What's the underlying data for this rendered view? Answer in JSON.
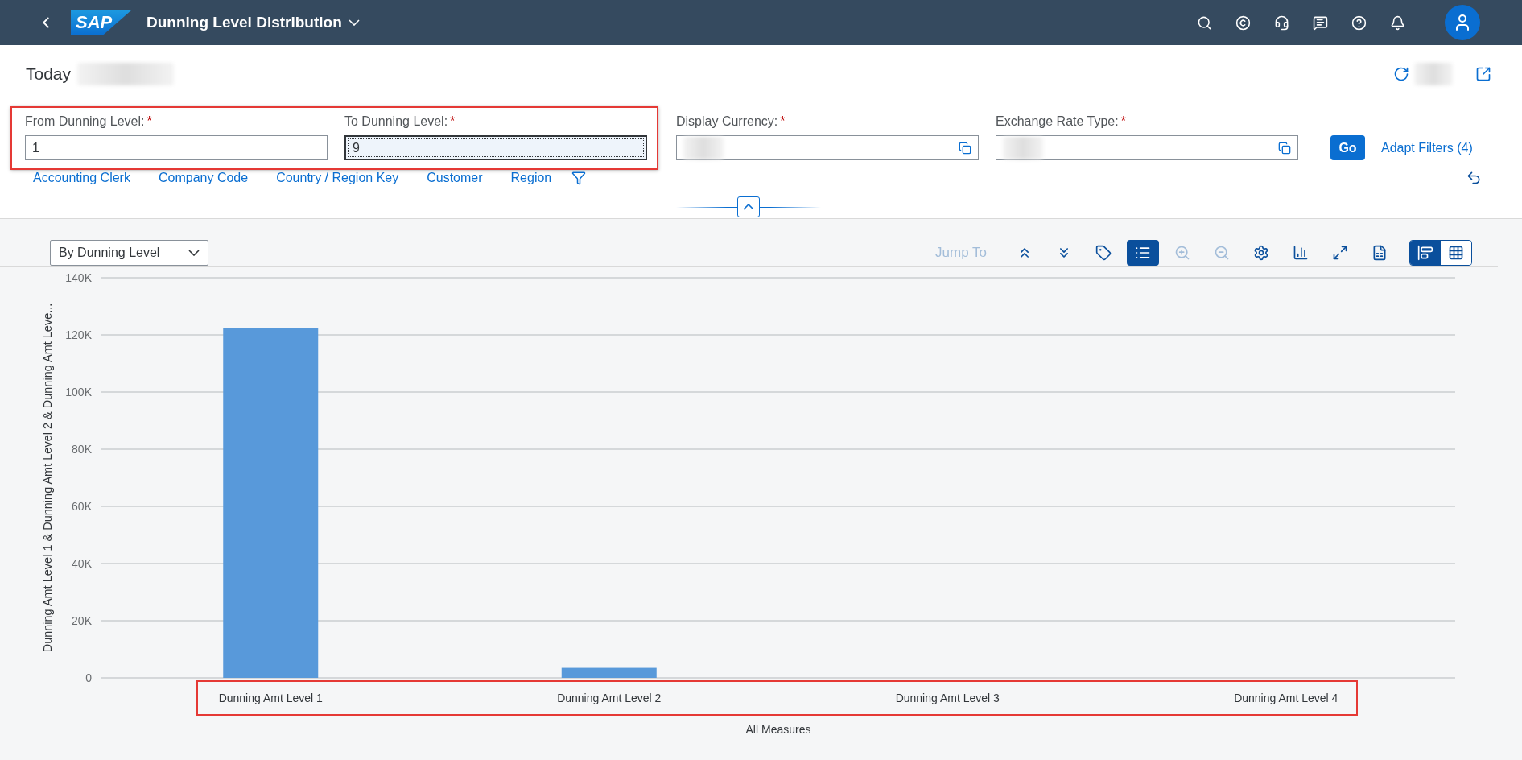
{
  "shell": {
    "logo": "SAP",
    "title": "Dunning Level Distribution"
  },
  "page": {
    "today_label": "Today"
  },
  "filter_groups": [
    {
      "highlighted": true,
      "fields": [
        {
          "label": "From Dunning Level:",
          "required_mark": "*",
          "kind": "text",
          "value": "1",
          "focused": false
        },
        {
          "label": "To Dunning Level:",
          "required_mark": "*",
          "kind": "text",
          "value": "9",
          "focused": true
        }
      ]
    },
    {
      "highlighted": false,
      "fields": [
        {
          "label": "Display Currency:",
          "required_mark": "*",
          "kind": "redacted",
          "focused": false
        },
        {
          "label": "Exchange Rate Type:",
          "required_mark": "*",
          "kind": "redacted",
          "focused": false
        }
      ]
    }
  ],
  "go_button": "Go",
  "adapt_filters": "Adapt Filters (4)",
  "filter_links": [
    "Accounting Clerk",
    "Company Code",
    "Country / Region Key",
    "Customer",
    "Region"
  ],
  "view_select": "By Dunning Level",
  "toolbar": {
    "jump_to": {
      "label": "Jump To",
      "disabled": true
    },
    "tools": [
      {
        "kind": "drill-up",
        "selected": false,
        "disabled": false
      },
      {
        "kind": "drill-down",
        "selected": false,
        "disabled": false
      },
      {
        "kind": "tag",
        "selected": false,
        "disabled": false
      },
      {
        "kind": "legend",
        "selected": true,
        "disabled": false
      },
      {
        "kind": "zoom-in",
        "selected": false,
        "disabled": true
      },
      {
        "kind": "zoom-out",
        "selected": false,
        "disabled": true
      },
      {
        "kind": "settings",
        "selected": false,
        "disabled": false
      },
      {
        "kind": "chart-type",
        "selected": false,
        "disabled": false
      },
      {
        "kind": "fullscreen",
        "selected": false,
        "disabled": false
      },
      {
        "kind": "export",
        "selected": false,
        "disabled": false
      }
    ],
    "views": [
      {
        "kind": "chart",
        "selected": true
      },
      {
        "kind": "table",
        "selected": false
      }
    ]
  },
  "chart": {
    "chart_data": {
      "type": "bar",
      "grid": true,
      "xlabel": "All Measures",
      "ylabel": "Dunning Amt Level 1 & Dunning Amt Level 2 & Dunning Amt Leve...",
      "categories": [
        "Dunning Amt Level 1",
        "Dunning Amt Level 2",
        "Dunning Amt Level 3",
        "Dunning Amt Level 4"
      ],
      "series": [
        {
          "color": "#5899da",
          "values": [
            122500,
            3500,
            0,
            0
          ]
        }
      ],
      "ylim": [
        0,
        140000
      ],
      "yticks": [
        {
          "value": 0,
          "label": "0"
        },
        {
          "value": 20000,
          "label": "20K"
        },
        {
          "value": 40000,
          "label": "40K"
        },
        {
          "value": 60000,
          "label": "60K"
        },
        {
          "value": 80000,
          "label": "80K"
        },
        {
          "value": 100000,
          "label": "100K"
        },
        {
          "value": 120000,
          "label": "120K"
        },
        {
          "value": 140000,
          "label": "140K"
        }
      ]
    }
  }
}
